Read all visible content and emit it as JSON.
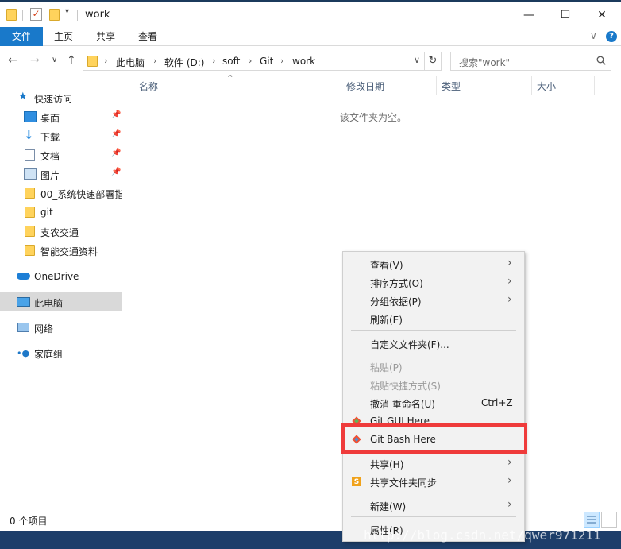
{
  "window": {
    "title": "work",
    "controls": {
      "minimize": "—",
      "maximize": "☐",
      "close": "✕"
    }
  },
  "ribbon": {
    "tabs": [
      "文件",
      "主页",
      "共享",
      "查看"
    ],
    "expand_glyph": "∨",
    "help_glyph": "?"
  },
  "address": {
    "breadcrumbs": [
      "此电脑",
      "软件 (D:)",
      "soft",
      "Git",
      "work"
    ],
    "search_placeholder": "搜索\"work\""
  },
  "nav_pane": {
    "quick_access": "快速访问",
    "items": [
      {
        "label": "桌面",
        "pinned": true,
        "icon": "desktop-icon"
      },
      {
        "label": "下载",
        "pinned": true,
        "icon": "download-icon"
      },
      {
        "label": "文档",
        "pinned": true,
        "icon": "document-icon"
      },
      {
        "label": "图片",
        "pinned": true,
        "icon": "picture-icon"
      },
      {
        "label": "00_系统快速部署指",
        "pinned": false,
        "icon": "folder-icon"
      },
      {
        "label": "git",
        "pinned": false,
        "icon": "folder-icon"
      },
      {
        "label": "支农交通",
        "pinned": false,
        "icon": "folder-icon"
      },
      {
        "label": "智能交通资料",
        "pinned": false,
        "icon": "folder-icon"
      }
    ],
    "onedrive": "OneDrive",
    "this_pc": "此电脑",
    "network": "网络",
    "homegroup": "家庭组"
  },
  "content": {
    "columns": [
      "名称",
      "修改日期",
      "类型",
      "大小"
    ],
    "empty_message": "该文件夹为空。"
  },
  "status": {
    "item_count": "0 个项目"
  },
  "context_menu": {
    "items": [
      {
        "label": "查看(V)",
        "submenu": true
      },
      {
        "label": "排序方式(O)",
        "submenu": true
      },
      {
        "label": "分组依据(P)",
        "submenu": true
      },
      {
        "label": "刷新(E)"
      },
      {
        "label": "自定义文件夹(F)..."
      },
      {
        "label": "粘贴(P)",
        "disabled": true
      },
      {
        "label": "粘贴快捷方式(S)",
        "disabled": true
      },
      {
        "label": "撤消 重命名(U)",
        "shortcut": "Ctrl+Z"
      },
      {
        "label": "Git GUI Here",
        "icon": "git-icon"
      },
      {
        "label": "Git Bash Here",
        "icon": "git-icon",
        "highlighted": true
      },
      {
        "label": "共享(H)",
        "submenu": true
      },
      {
        "label": "共享文件夹同步",
        "submenu": true,
        "icon": "sync-icon"
      },
      {
        "label": "新建(W)",
        "submenu": true
      },
      {
        "label": "属性(R)"
      }
    ],
    "highlight_color": "#ef3b3b"
  },
  "watermark": "http://blog.csdn.net/qwer971211",
  "colors": {
    "accent": "#1979ca",
    "folder": "#ffd35c",
    "selected_nav": "#d9d9d9"
  }
}
